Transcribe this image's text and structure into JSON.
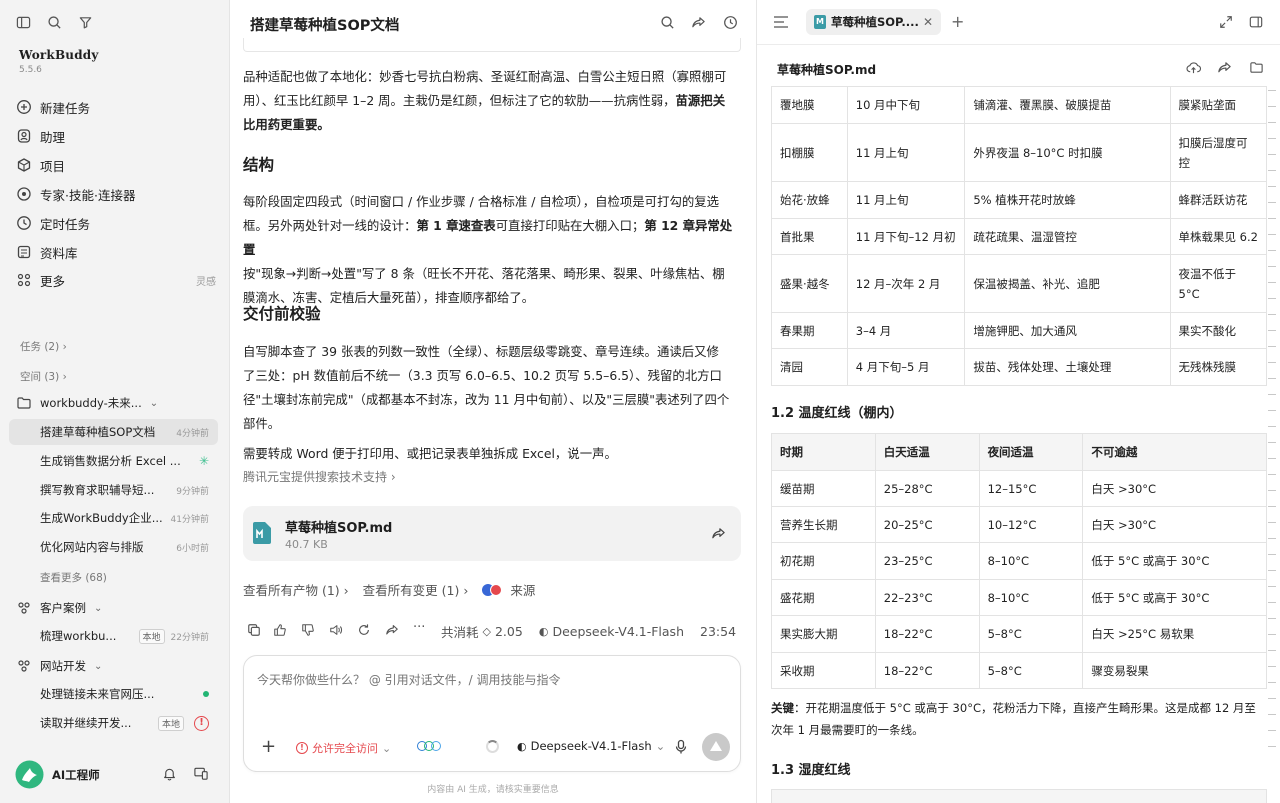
{
  "sidebar": {
    "app_name": "WorkBuddy",
    "version": "5.5.6",
    "nav": [
      {
        "label": "新建任务",
        "icon": "plus-circle-icon"
      },
      {
        "label": "助理",
        "icon": "assistant-icon"
      },
      {
        "label": "项目",
        "icon": "project-icon"
      },
      {
        "label": "专家·技能·连接器",
        "icon": "experts-icon"
      },
      {
        "label": "定时任务",
        "icon": "clock-icon"
      },
      {
        "label": "资料库",
        "icon": "library-icon"
      },
      {
        "label": "更多",
        "icon": "grid-icon",
        "sub": "灵感"
      }
    ],
    "tasks_label": "任务 (2)",
    "spaces_label": "空间 (3)",
    "space1": {
      "name": "workbuddy-未来...",
      "tasks": [
        {
          "title": "搭建草莓种植SOP文档",
          "time": "4分钟前",
          "active": true
        },
        {
          "title": "生成销售数据分析 Excel ...",
          "time": "",
          "spinner": true
        },
        {
          "title": "撰写教育求职辅导短...",
          "time": "9分钟前"
        },
        {
          "title": "生成WorkBuddy企业...",
          "time": "41分钟前"
        },
        {
          "title": "优化网站内容与排版",
          "time": "6小时前"
        }
      ],
      "more": "查看更多 (68)"
    },
    "space2": {
      "name": "客户案例",
      "tasks": [
        {
          "title": "梳理workbu...",
          "badge": "本地",
          "time": "22分钟前"
        }
      ]
    },
    "space3": {
      "name": "网站开发",
      "tasks": [
        {
          "title": "处理链接未来官网压...",
          "status": "green-dot"
        },
        {
          "title": "读取并继续开发...",
          "badge": "本地",
          "status": "error"
        }
      ]
    },
    "user": "AI工程师"
  },
  "chat": {
    "title": "搭建草莓种植SOP文档",
    "paragraphs": {
      "p1a": "品种适配也做了本地化：妙香七号抗白粉病、圣诞红耐高温、白雪公主短日照（寡照棚可",
      "p1b": "用）、红玉比红颜早 1–2 周。主栽仍是红颜，但标注了它的软肋——抗病性弱，",
      "p1b_bold": "苗源把关",
      "p1c_bold": "比用药更重要。",
      "h_structure": "结构",
      "p2a": "每阶段固定四段式（时间窗口 / 作业步骤 / 合格标准 / 自检项），自检项是可打勾的复选",
      "p2b": "框。另外两处针对一线的设计：",
      "p2b_bold1": "第 1 章速查表",
      "p2b_mid": "可直接打印贴在大棚入口；",
      "p2b_bold2": "第 12 章异常处置",
      "p2c": "按\"现象→判断→处置\"写了 8 条（旺长不开花、落花落果、畸形果、裂果、叶缘焦枯、棚",
      "p2d": "膜滴水、冻害、定植后大量死苗），排查顺序都给了。",
      "h_check": "交付前校验",
      "p3a": "自写脚本查了 39 张表的列数一致性（全绿）、标题层级零跳变、章号连续。通读后又修",
      "p3b": "了三处：pH 数值前后不统一（3.3 页写 6.0–6.5、10.2 页写 5.5–6.5）、残留的北方口",
      "p3c": "径\"土壤封冻前完成\"（成都基本不封冻，改为 11 月中旬前）、以及\"三层膜\"表述列了四个",
      "p3d": "部件。",
      "p4": "需要转成 Word 便于打印用、或把记录表单独拆成 Excel，说一声。",
      "search_credit": "腾讯元宝提供搜索技术支持"
    },
    "file": {
      "name": "草莓种植SOP.md",
      "size": "40.7 KB"
    },
    "links": {
      "artifacts": "查看所有产物 (1)",
      "changes": "查看所有变更 (1)",
      "source": "来源"
    },
    "meta": {
      "cost_label": "共消耗",
      "cost": "2.05",
      "model": "Deepseek-V4.1-Flash",
      "time": "23:54"
    },
    "composer": {
      "placeholder": "今天帮你做些什么？ @ 引用对话文件，/ 调用技能与指令",
      "access": "允许完全访问",
      "model": "Deepseek-V4.1-Flash"
    },
    "disclaimer": "内容由 AI 生成，请核实重要信息"
  },
  "doc": {
    "tab": "草莓种植SOP....",
    "filename": "草莓种植SOP.md",
    "table1": [
      [
        "覆地膜",
        "10 月中下旬",
        "铺滴灌、覆黑膜、破膜提苗",
        "膜紧贴垄面"
      ],
      [
        "扣棚膜",
        "11 月上旬",
        "外界夜温 8–10°C 时扣膜",
        "扣膜后湿度可控"
      ],
      [
        "始花·放蜂",
        "11 月上旬",
        "5% 植株开花时放蜂",
        "蜂群活跃访花"
      ],
      [
        "首批果",
        "11 月下旬–12 月初",
        "疏花疏果、温湿管控",
        "单株载果见 6.2"
      ],
      [
        "盛果·越冬",
        "12 月–次年 2 月",
        "保温被揭盖、补光、追肥",
        "夜温不低于 5°C"
      ],
      [
        "春果期",
        "3–4 月",
        "增施钾肥、加大通风",
        "果实不酸化"
      ],
      [
        "清园",
        "4 月下旬–5 月",
        "拔苗、残体处理、土壤处理",
        "无残株残膜"
      ]
    ],
    "h12": "1.2 温度红线（棚内）",
    "table2_head": [
      "时期",
      "白天适温",
      "夜间适温",
      "不可逾越"
    ],
    "table2": [
      [
        "缓苗期",
        "25–28°C",
        "12–15°C",
        "白天 >30°C"
      ],
      [
        "营养生长期",
        "20–25°C",
        "10–12°C",
        "白天 >30°C"
      ],
      [
        "初花期",
        "23–25°C",
        "8–10°C",
        "低于 5°C 或高于 30°C"
      ],
      [
        "盛花期",
        "22–23°C",
        "8–10°C",
        "低于 5°C 或高于 30°C"
      ],
      [
        "果实膨大期",
        "18–22°C",
        "5–8°C",
        "白天 >25°C 易软果"
      ],
      [
        "采收期",
        "18–22°C",
        "5–8°C",
        "骤变易裂果"
      ]
    ],
    "key_label": "关键",
    "key_text_a": "：开花期温度低于 5°C 或高于 30°C，花粉活力下降，直接产生畸形果。这是成都 12 月至",
    "key_text_b": "次年 1 月最需要盯的一条线。",
    "h13": "1.3 湿度红线"
  }
}
